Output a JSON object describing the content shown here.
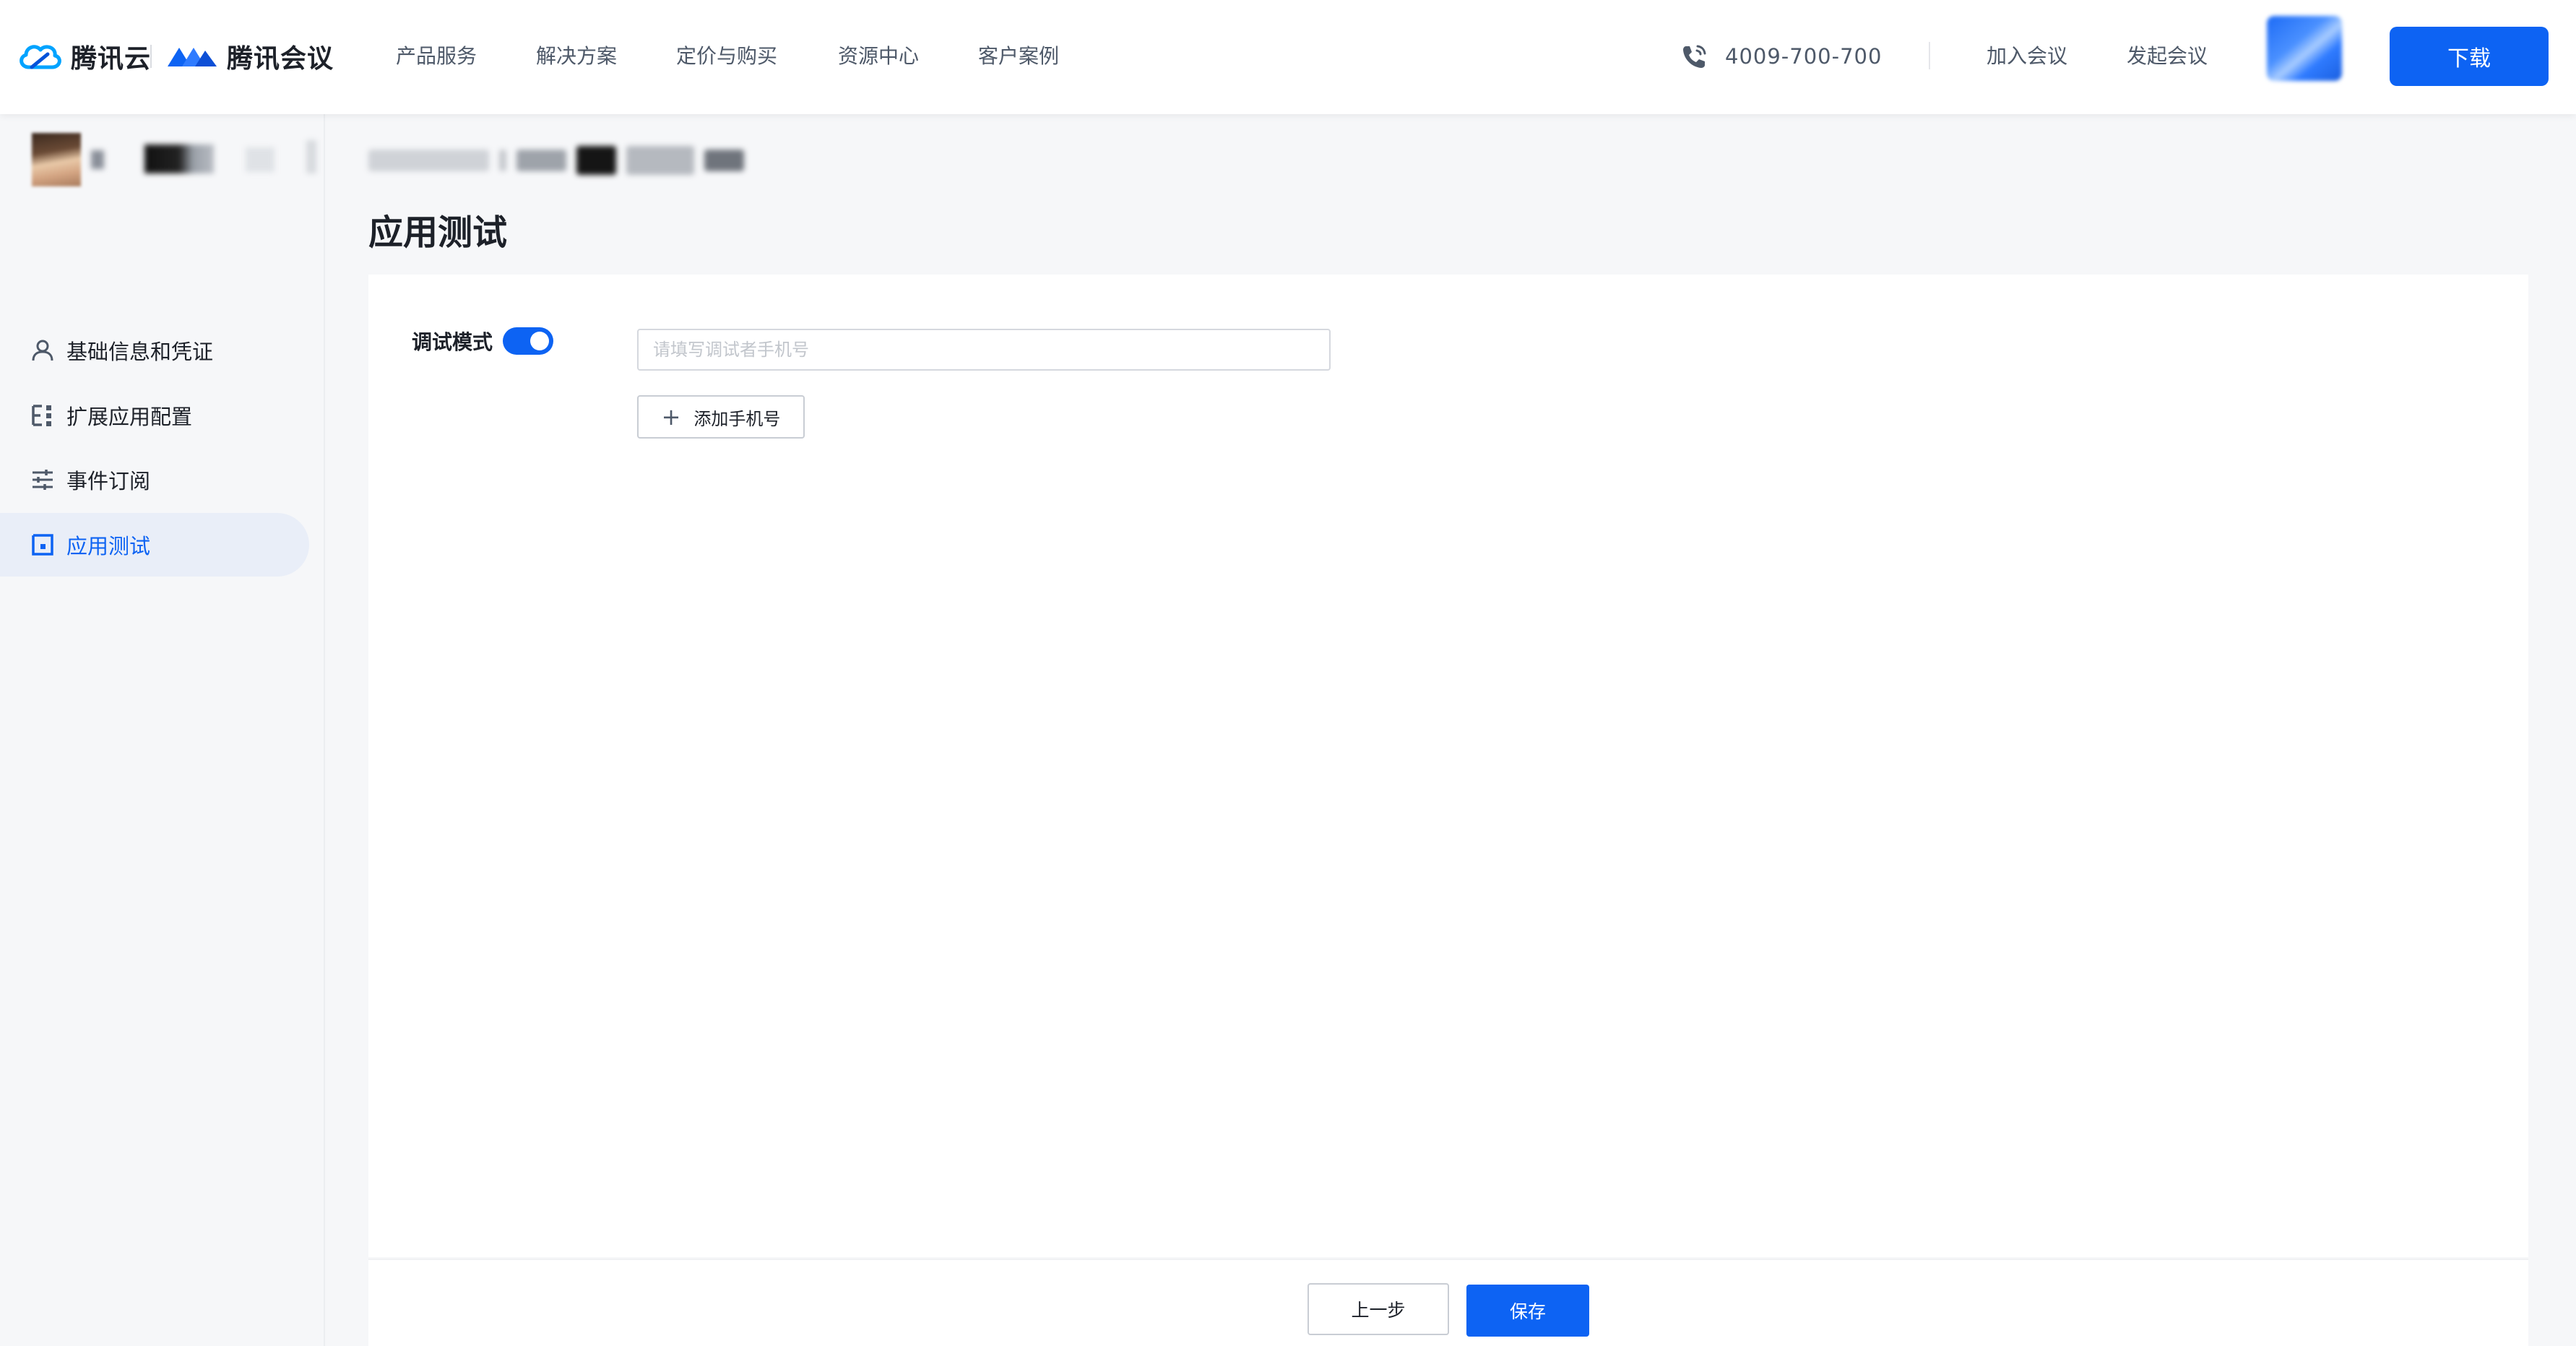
{
  "header": {
    "brand_cloud": "腾讯云",
    "brand_meeting": "腾讯会议",
    "nav": [
      "产品服务",
      "解决方案",
      "定价与购买",
      "资源中心",
      "客户案例"
    ],
    "phone": "4009-700-700",
    "join_meeting": "加入会议",
    "start_meeting": "发起会议",
    "download": "下载"
  },
  "sidebar": {
    "items": [
      {
        "label": "基础信息和凭证",
        "icon": "user-icon",
        "active": false
      },
      {
        "label": "扩展应用配置",
        "icon": "config-list-icon",
        "active": false
      },
      {
        "label": "事件订阅",
        "icon": "sliders-icon",
        "active": false
      },
      {
        "label": "应用测试",
        "icon": "test-frame-icon",
        "active": true
      }
    ]
  },
  "main": {
    "title": "应用测试",
    "debug_mode_label": "调试模式",
    "debug_mode_on": true,
    "phone_placeholder": "请填写调试者手机号",
    "phone_value": "",
    "add_phone": "添加手机号"
  },
  "footer": {
    "prev": "上一步",
    "save": "保存"
  },
  "colors": {
    "primary": "#0d63f3",
    "active_bg": "#e9eef8",
    "page_bg": "#f6f7f9"
  }
}
